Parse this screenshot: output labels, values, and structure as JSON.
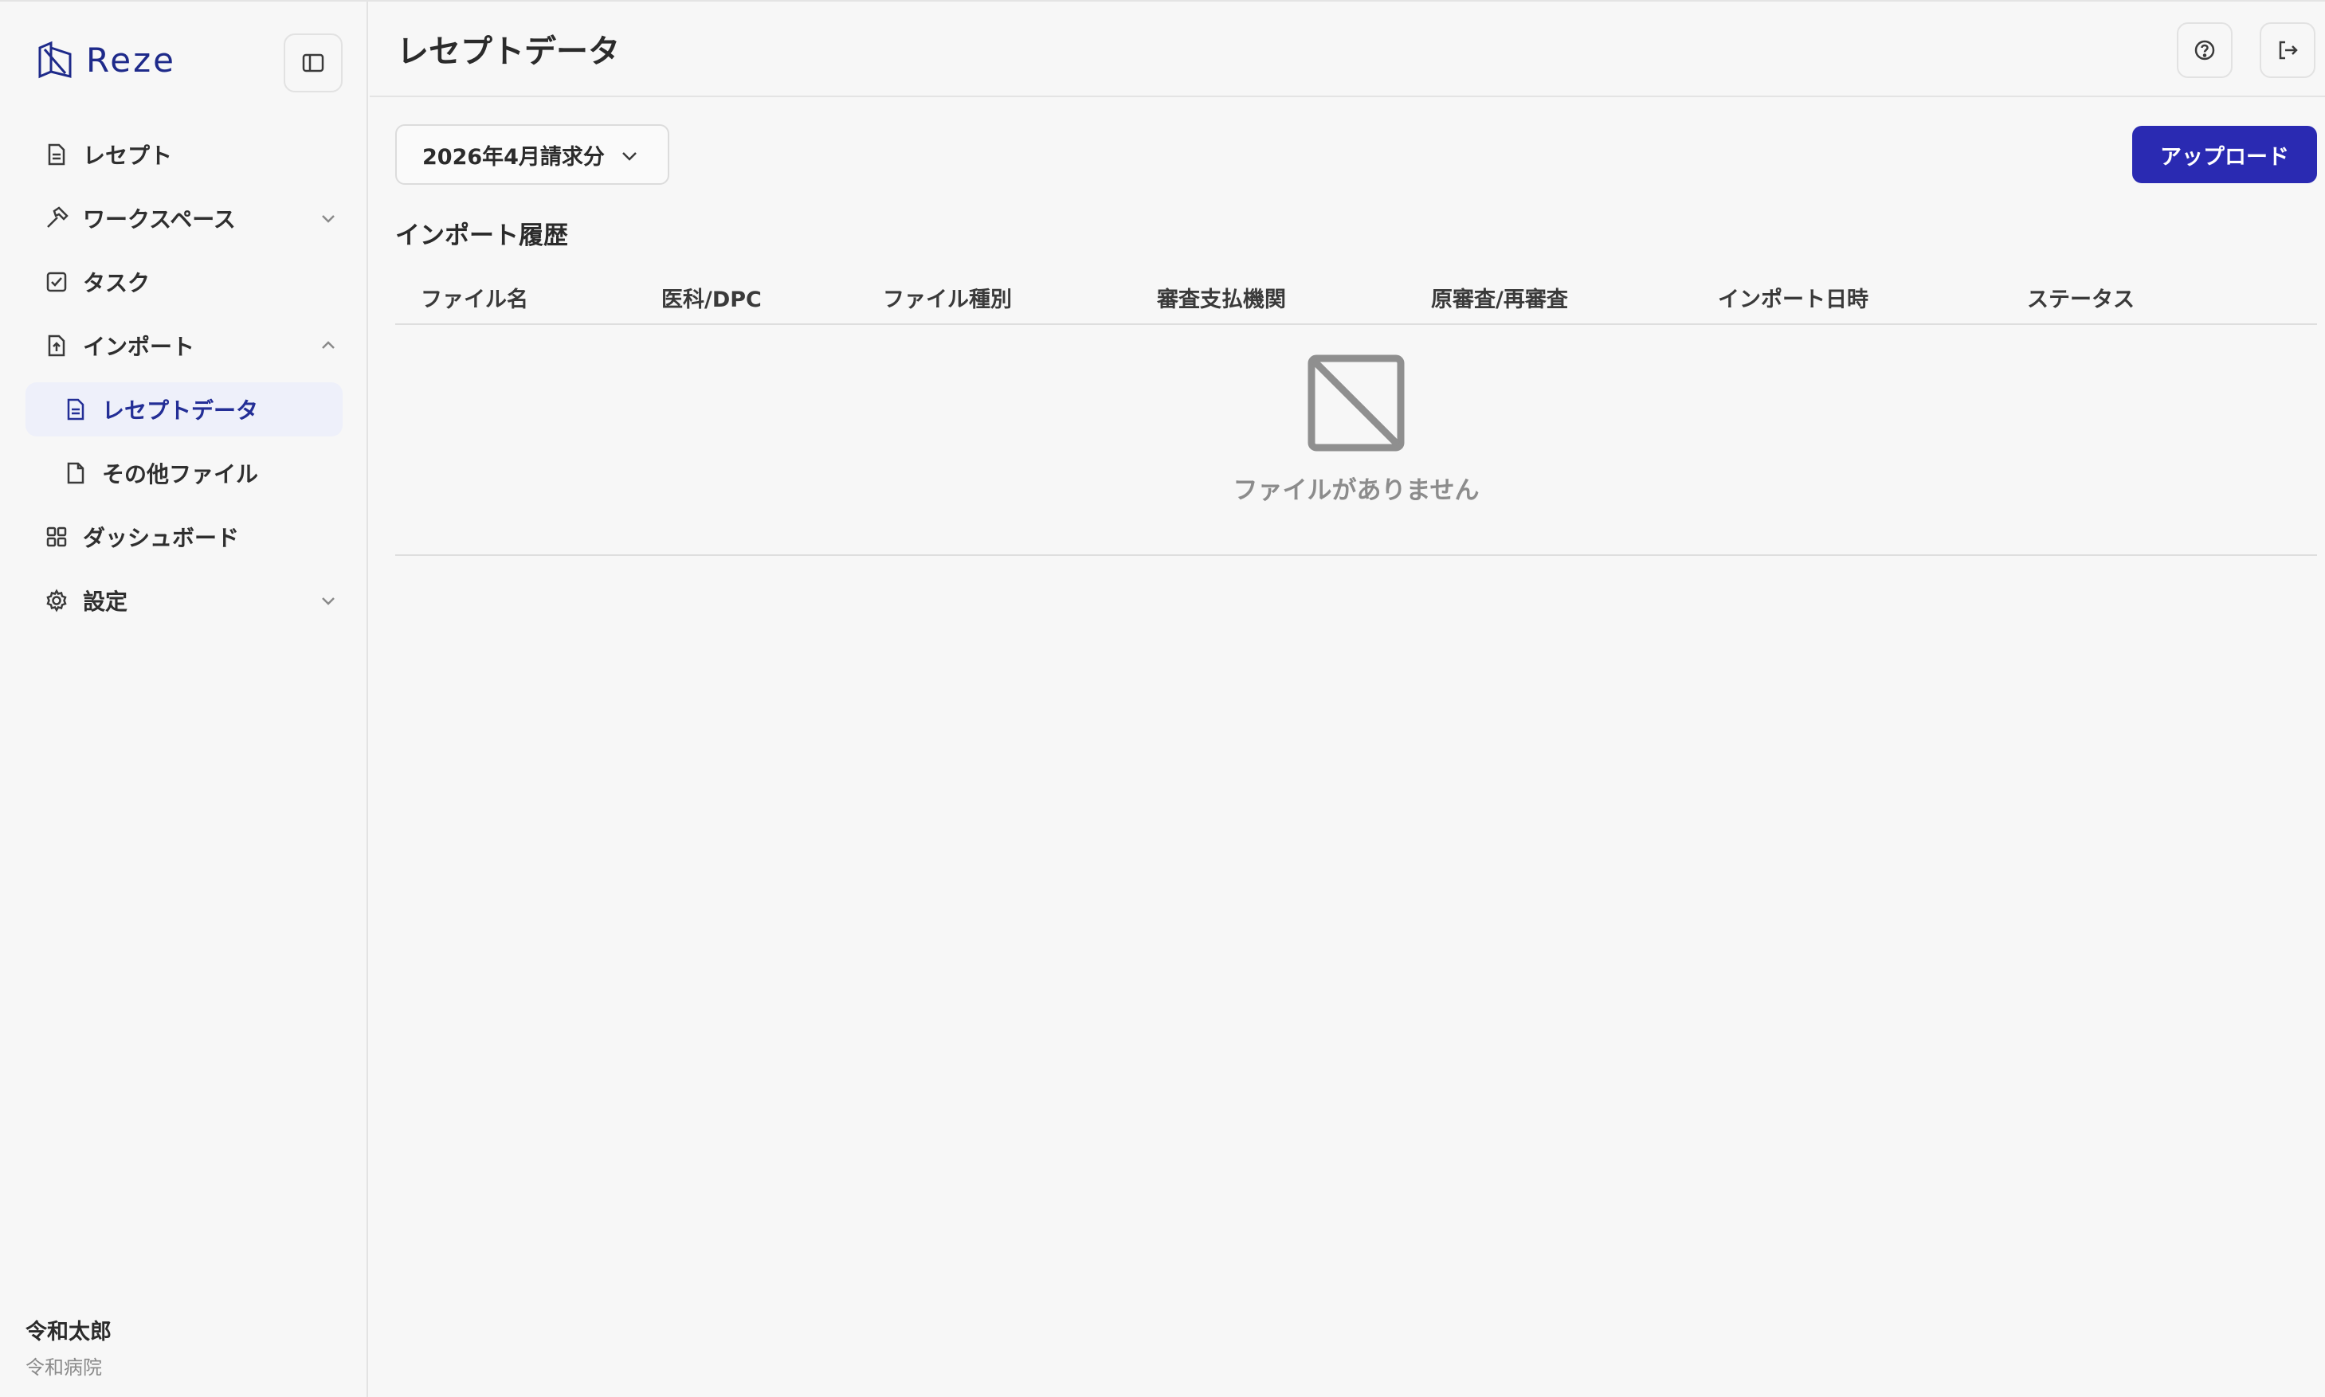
{
  "app": {
    "logo_text": "Reze"
  },
  "sidebar": {
    "items": [
      {
        "label": "レセプト"
      },
      {
        "label": "ワークスペース"
      },
      {
        "label": "タスク"
      },
      {
        "label": "インポート"
      },
      {
        "label": "レセプトデータ"
      },
      {
        "label": "その他ファイル"
      },
      {
        "label": "ダッシュボード"
      },
      {
        "label": "設定"
      }
    ]
  },
  "user": {
    "name": "令和太郎",
    "organization": "令和病院"
  },
  "header": {
    "title": "レセプトデータ"
  },
  "toolbar": {
    "period_selected": "2026年4月請求分",
    "upload_label": "アップロード"
  },
  "imports": {
    "title": "インポート履歴",
    "columns": [
      "ファイル名",
      "医科/DPC",
      "ファイル種別",
      "審査支払機関",
      "原審査/再審査",
      "インポート日時",
      "ステータス"
    ],
    "rows": [],
    "empty_text": "ファイルがありません"
  },
  "colors": {
    "accent": "#2a2ab2",
    "active_bg": "#eef0fa",
    "active_text": "#232e96",
    "background": "#f7f7f7"
  },
  "icons": {
    "logo": "reze-logo-icon",
    "collapse": "sidebar-toggle-icon",
    "help": "help-circle-icon",
    "logout": "logout-icon",
    "empty": "no-image-icon"
  }
}
